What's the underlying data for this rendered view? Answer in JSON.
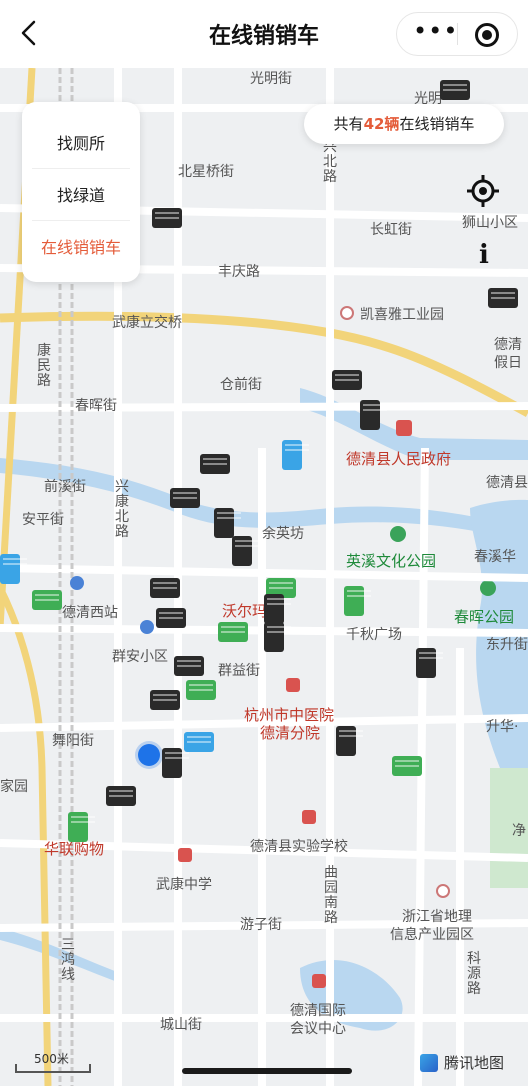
{
  "header": {
    "title": "在线销销车"
  },
  "menu": {
    "items": [
      {
        "label": "找厕所",
        "active": false
      },
      {
        "label": "找绿道",
        "active": false
      },
      {
        "label": "在线销销车",
        "active": true
      }
    ]
  },
  "count_pill": {
    "prefix": "共有",
    "count": "42辆",
    "suffix": "在线销销车"
  },
  "info_button": "i",
  "map": {
    "roads": [
      "光明街",
      "北星桥街",
      "丰庆路",
      "长虹街",
      "武康立交桥",
      "春晖街",
      "仓前街",
      "前溪街",
      "安平街",
      "余英坊",
      "舞阳街",
      "游子街",
      "城山街",
      "群益街"
    ],
    "vertical_roads": [
      "兴北路",
      "康民路",
      "兴康北路",
      "曲园南路",
      "三鸿线",
      "科源路"
    ],
    "places": [
      "狮山小区",
      "凯喜雅工业园",
      "德清",
      "假日",
      "德清县人民政府",
      "德清县",
      "英溪文化公园",
      "春溪华",
      "春晖公园",
      "东升街",
      "千秋广场",
      "德清西站",
      "群安小区",
      "沃尔玛",
      "杭州市中医院",
      "德清分院",
      "升华·",
      "家园",
      "净",
      "华联购物",
      "德清县实验学校",
      "武康中学",
      "浙江省地理",
      "信息产业园区",
      "德清国际",
      "会议中心",
      "光明"
    ]
  },
  "scale": "500米",
  "brand": "腾讯地图"
}
